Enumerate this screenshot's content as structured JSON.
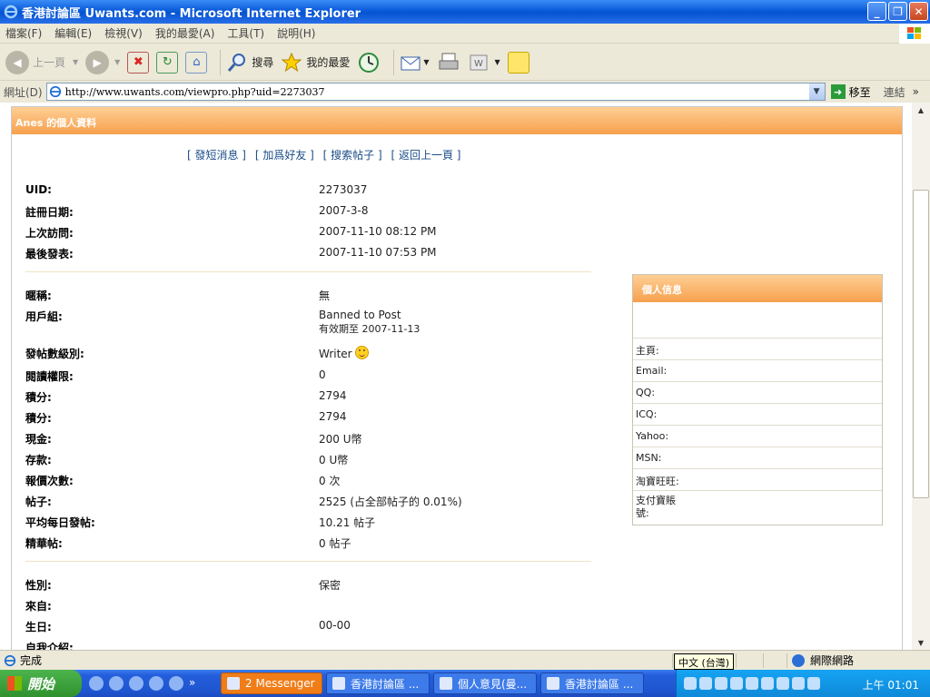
{
  "window": {
    "title": "香港討論區 Uwants.com - Microsoft Internet Explorer"
  },
  "menu": [
    "檔案(F)",
    "編輯(E)",
    "檢視(V)",
    "我的最愛(A)",
    "工具(T)",
    "說明(H)"
  ],
  "toolbar": {
    "back": "上一頁",
    "search": "搜尋",
    "favorites": "我的最愛"
  },
  "address": {
    "label": "網址(D)",
    "url": "http://www.uwants.com/viewpro.php?uid=2273037",
    "go": "移至",
    "links": "連結"
  },
  "profile": {
    "title": "Anes 的個人資料",
    "actions": [
      "[ 發短消息 ]",
      "[ 加爲好友 ]",
      "[ 搜索帖子 ]",
      "[ 返回上一頁 ]"
    ],
    "group1": [
      {
        "k": "UID:",
        "v": "2273037"
      },
      {
        "k": "註冊日期:",
        "v": "2007-3-8"
      },
      {
        "k": "上次訪問:",
        "v": "2007-11-10 08:12 PM"
      },
      {
        "k": "最後發表:",
        "v": "2007-11-10 07:53 PM"
      }
    ],
    "nickname": {
      "k": "暱稱:",
      "v": "無"
    },
    "usergroup": {
      "k": "用戶組:",
      "v": "Banned to Post",
      "sub": "有效期至 2007-11-13"
    },
    "rank": {
      "k": "發帖數級別:",
      "v": "Writer"
    },
    "group2": [
      {
        "k": "閱讀權限:",
        "v": "0"
      },
      {
        "k": "積分:",
        "v": "2794"
      },
      {
        "k": "積分:",
        "v": "2794"
      },
      {
        "k": "現金:",
        "v": "200 U幣"
      },
      {
        "k": "存款:",
        "v": "0 U幣"
      },
      {
        "k": "報價次數:",
        "v": "0 次"
      },
      {
        "k": "帖子:",
        "v": "2525 (占全部帖子的 0.01%)"
      },
      {
        "k": "平均每日發帖:",
        "v": "10.21 帖子"
      },
      {
        "k": "精華帖:",
        "v": "0 帖子"
      }
    ],
    "group3": [
      {
        "k": "性別:",
        "v": "保密"
      },
      {
        "k": "來自:",
        "v": ""
      },
      {
        "k": "生日:",
        "v": "00-00"
      },
      {
        "k": "自我介紹:",
        "v": ""
      }
    ]
  },
  "side": {
    "title": "個人信息",
    "items": [
      "主頁:",
      "Email:",
      "QQ:",
      "ICQ:",
      "Yahoo:",
      "MSN:",
      "淘寶旺旺:"
    ],
    "alipay": [
      "支付寶賬",
      "號:"
    ]
  },
  "status": {
    "text": "完成",
    "ime": "中文 (台灣)",
    "zone": "網際網路"
  },
  "taskbar": {
    "start": "開始",
    "tasks": [
      {
        "label": "2 Messenger",
        "active": true
      },
      {
        "label": "香港討論區 ...",
        "active": false
      },
      {
        "label": "個人意見(曼...",
        "active": false
      },
      {
        "label": "香港討論區 ...",
        "active": false
      }
    ],
    "clock": "上午 01:01"
  }
}
